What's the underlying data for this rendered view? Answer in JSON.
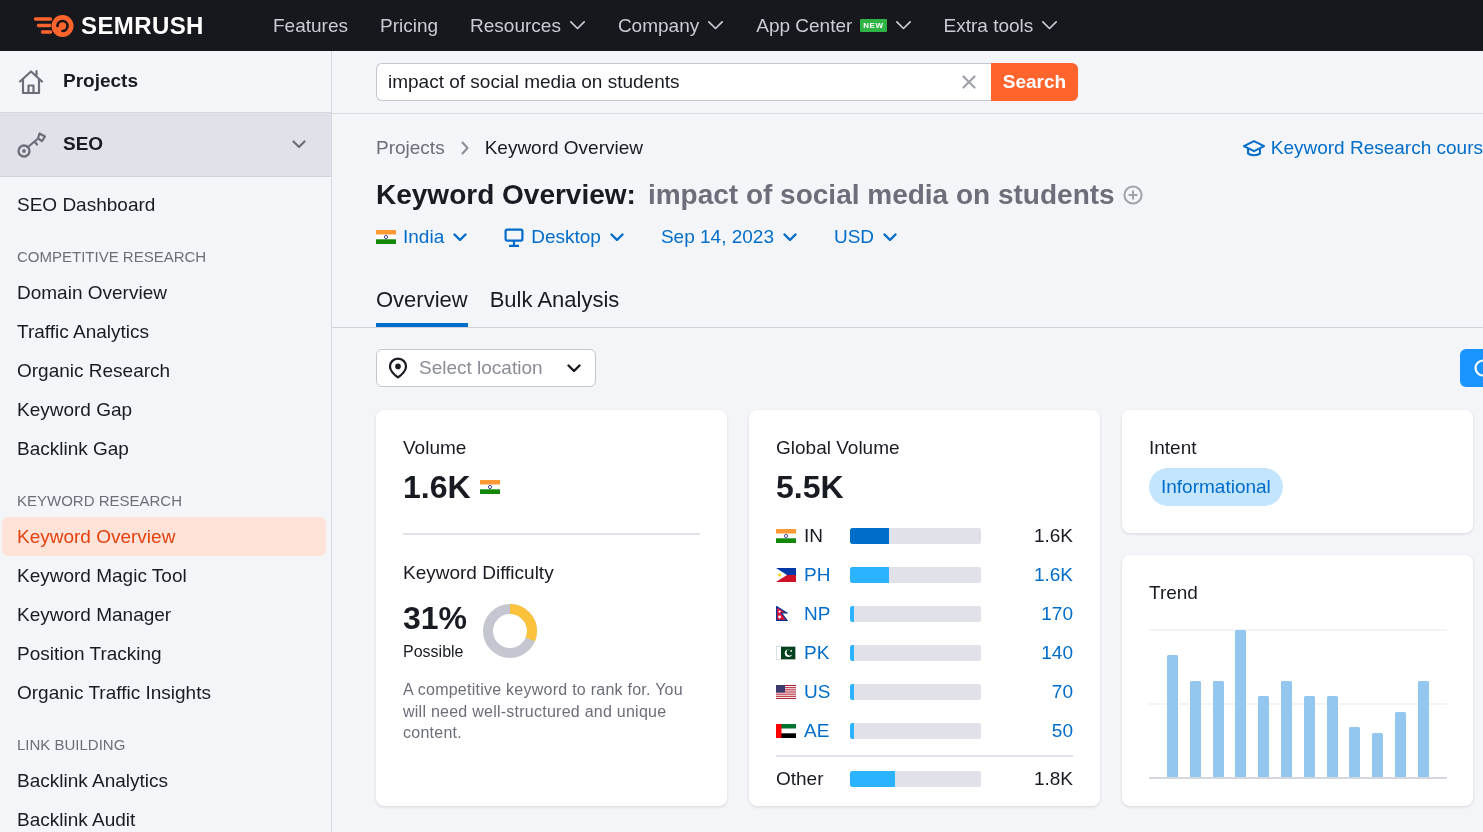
{
  "top_nav": {
    "logo": "SEMRUSH",
    "items": [
      {
        "label": "Features",
        "has_menu": false
      },
      {
        "label": "Pricing",
        "has_menu": false
      },
      {
        "label": "Resources",
        "has_menu": true
      },
      {
        "label": "Company",
        "has_menu": true
      },
      {
        "label": "App Center",
        "badge": "NEW",
        "has_menu": true
      },
      {
        "label": "Extra tools",
        "has_menu": true
      }
    ]
  },
  "sidebar": {
    "projects": "Projects",
    "section": {
      "label": "SEO",
      "expanded": true
    },
    "groups": [
      {
        "items": [
          {
            "label": "SEO Dashboard",
            "selected": false
          }
        ]
      },
      {
        "heading": "COMPETITIVE RESEARCH",
        "items": [
          {
            "label": "Domain Overview",
            "selected": false
          },
          {
            "label": "Traffic Analytics",
            "selected": false
          },
          {
            "label": "Organic Research",
            "selected": false
          },
          {
            "label": "Keyword Gap",
            "selected": false
          },
          {
            "label": "Backlink Gap",
            "selected": false
          }
        ]
      },
      {
        "heading": "KEYWORD RESEARCH",
        "items": [
          {
            "label": "Keyword Overview",
            "selected": true
          },
          {
            "label": "Keyword Magic Tool",
            "selected": false
          },
          {
            "label": "Keyword Manager",
            "selected": false
          },
          {
            "label": "Position Tracking",
            "selected": false
          },
          {
            "label": "Organic Traffic Insights",
            "selected": false
          }
        ]
      },
      {
        "heading": "LINK BUILDING",
        "items": [
          {
            "label": "Backlink Analytics",
            "selected": false
          },
          {
            "label": "Backlink Audit",
            "selected": false
          }
        ]
      }
    ]
  },
  "search": {
    "value": "impact of social media on students",
    "button": "Search"
  },
  "breadcrumb": [
    "Projects",
    "Keyword Overview"
  ],
  "course_link": "Keyword Research cours",
  "title": {
    "label": "Keyword Overview:",
    "keyword": "impact of social media on students"
  },
  "filters": [
    {
      "kind": "country",
      "label": "India"
    },
    {
      "kind": "device",
      "label": "Desktop"
    },
    {
      "kind": "date",
      "label": "Sep 14, 2023"
    },
    {
      "kind": "currency",
      "label": "USD"
    }
  ],
  "tabs": [
    {
      "label": "Overview",
      "selected": true
    },
    {
      "label": "Bulk Analysis",
      "selected": false
    }
  ],
  "location_select": {
    "placeholder": "Select location"
  },
  "volume": {
    "title": "Volume",
    "value": "1.6K"
  },
  "difficulty": {
    "title": "Keyword Difficulty",
    "value": "31%",
    "level": 0.31,
    "rating": "Possible",
    "description": "A competitive keyword to rank for. You will need well-structured and unique content."
  },
  "global_volume": {
    "title": "Global Volume",
    "value": "5.5K",
    "countries": [
      {
        "code": "IN",
        "value": "1.6K",
        "level": 0.3,
        "selected": true
      },
      {
        "code": "PH",
        "value": "1.6K",
        "level": 0.3,
        "selected": false
      },
      {
        "code": "NP",
        "value": "170",
        "level": 0.03,
        "selected": false
      },
      {
        "code": "PK",
        "value": "140",
        "level": 0.03,
        "selected": false
      },
      {
        "code": "US",
        "value": "70",
        "level": 0.03,
        "selected": false
      },
      {
        "code": "AE",
        "value": "50",
        "level": 0.03,
        "selected": false
      }
    ],
    "other": {
      "label": "Other",
      "value": "1.8K",
      "level": 0.34
    }
  },
  "intent": {
    "title": "Intent",
    "tags": [
      "Informational"
    ]
  },
  "trend": {
    "title": "Trend"
  }
}
